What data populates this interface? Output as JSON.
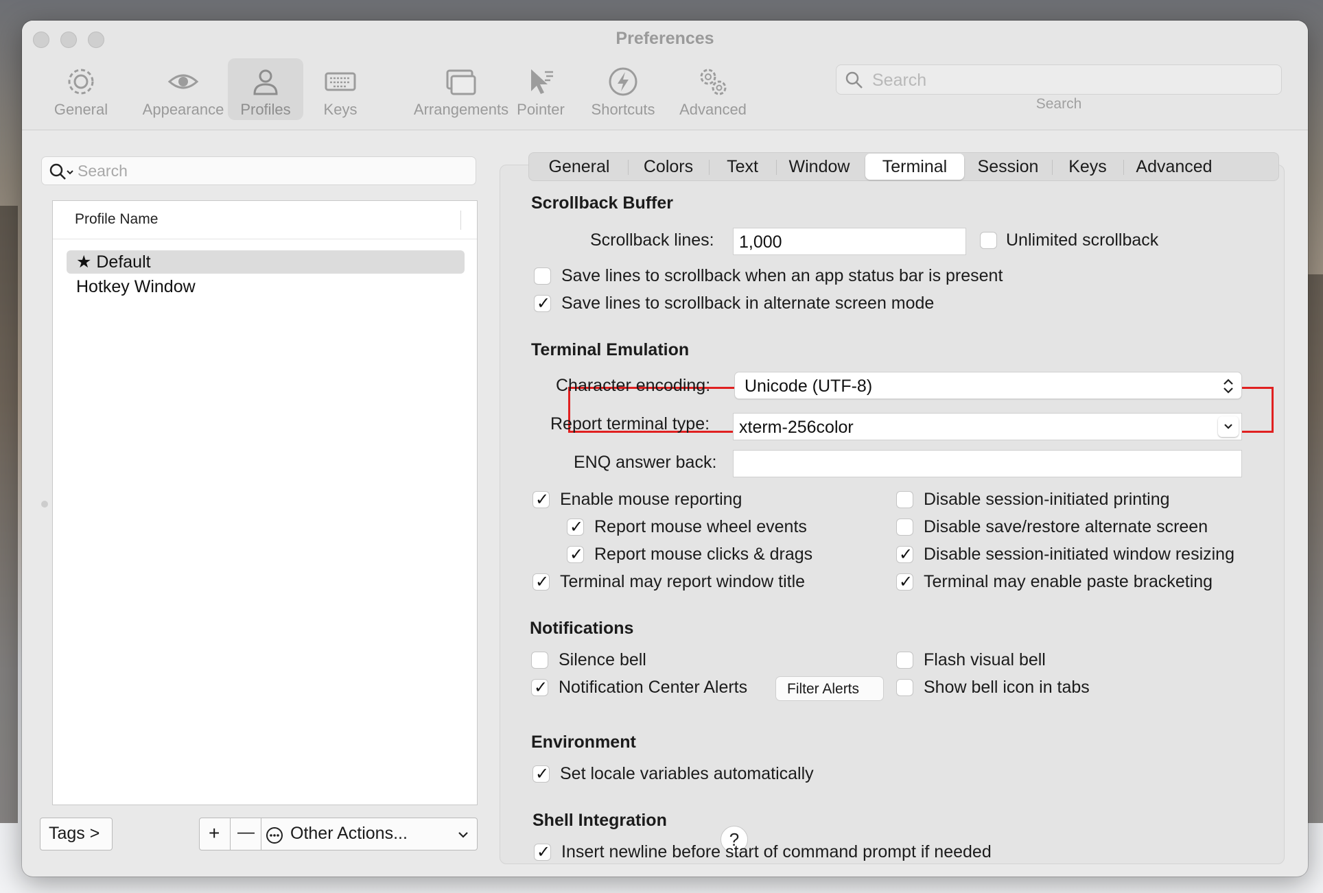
{
  "window": {
    "title": "Preferences"
  },
  "toolbar": {
    "items": [
      {
        "label": "General",
        "icon": "gear-icon"
      },
      {
        "label": "Appearance",
        "icon": "eye-icon"
      },
      {
        "label": "Profiles",
        "icon": "person-icon",
        "selected": true
      },
      {
        "label": "Keys",
        "icon": "keyboard-icon"
      },
      {
        "label": "Arrangements",
        "icon": "windows-icon"
      },
      {
        "label": "Pointer",
        "icon": "pointer-icon"
      },
      {
        "label": "Shortcuts",
        "icon": "bolt-icon"
      },
      {
        "label": "Advanced",
        "icon": "gears-icon"
      }
    ],
    "search": {
      "placeholder": "Search",
      "caption": "Search"
    }
  },
  "sidebar": {
    "search_placeholder": "Search",
    "column_header": "Profile Name",
    "profiles": [
      {
        "name": "Default",
        "star": "★",
        "selected": true
      },
      {
        "name": "Hotkey Window"
      }
    ],
    "tags_button": "Tags >",
    "add_button": "+",
    "remove_button": "—",
    "other_actions": "Other Actions..."
  },
  "tabs": [
    "General",
    "Colors",
    "Text",
    "Window",
    "Terminal",
    "Session",
    "Keys",
    "Advanced"
  ],
  "selected_tab": "Terminal",
  "scrollback": {
    "title": "Scrollback Buffer",
    "lines_label": "Scrollback lines:",
    "lines_value": "1,000",
    "unlimited_label": "Unlimited scrollback",
    "unlimited_checked": false,
    "status_bar_label": "Save lines to scrollback when an app status bar is present",
    "status_bar_checked": false,
    "alternate_label": "Save lines to scrollback in alternate screen mode",
    "alternate_checked": true
  },
  "emulation": {
    "title": "Terminal Emulation",
    "encoding_label": "Character encoding:",
    "encoding_value": "Unicode (UTF-8)",
    "terminal_type_label": "Report terminal type:",
    "terminal_type_value": "xterm-256color",
    "enq_label": "ENQ answer back:",
    "enq_value": "",
    "options_left": [
      {
        "label": "Enable mouse reporting",
        "checked": true
      },
      {
        "label": "Report mouse wheel events",
        "checked": true
      },
      {
        "label": "Report mouse clicks & drags",
        "checked": true
      },
      {
        "label": "Terminal may report window title",
        "checked": true
      }
    ],
    "options_right": [
      {
        "label": "Disable session-initiated printing",
        "checked": false
      },
      {
        "label": "Disable save/restore alternate screen",
        "checked": false
      },
      {
        "label": "Disable session-initiated window resizing",
        "checked": true
      },
      {
        "label": "Terminal may enable paste bracketing",
        "checked": true
      }
    ]
  },
  "notifications": {
    "title": "Notifications",
    "silence_bell": "Silence bell",
    "silence_checked": false,
    "nc_alerts": "Notification Center Alerts",
    "nc_checked": true,
    "filter_button": "Filter Alerts",
    "flash_bell": "Flash visual bell",
    "flash_checked": false,
    "bell_icon": "Show bell icon in tabs",
    "bell_icon_checked": false
  },
  "environment": {
    "title": "Environment",
    "locale_label": "Set locale variables automatically",
    "locale_checked": true
  },
  "shell": {
    "title": "Shell Integration",
    "help": "?",
    "newline_label": "Insert newline before start of command prompt if needed",
    "newline_checked": true
  },
  "colors": {
    "highlight": "#e02020",
    "window_bg": "#e9e9e9"
  }
}
